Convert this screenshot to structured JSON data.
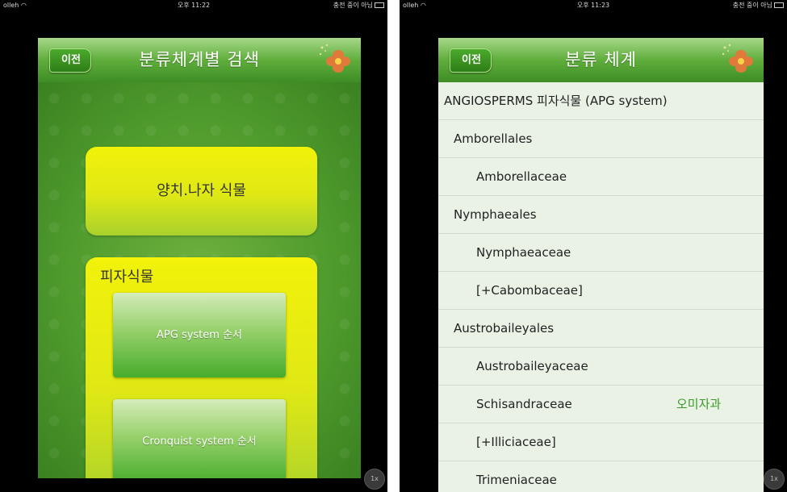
{
  "left": {
    "status": {
      "carrier": "olleh",
      "time": "오후 11:22",
      "charging": "충전 중이 아님"
    },
    "header": {
      "back_label": "이전",
      "title": "분류체계별 검색"
    },
    "gymnosperm_label": "양치.나자 식물",
    "angiosperm": {
      "title": "피자식물",
      "apg_label": "APG system 순서",
      "cronquist_label": "Cronquist system 순서"
    },
    "zoom": "1x"
  },
  "right": {
    "status": {
      "carrier": "olleh",
      "time": "오후 11:23",
      "charging": "충전 중이 아님"
    },
    "header": {
      "back_label": "이전",
      "title": "분류 체계"
    },
    "rows": [
      {
        "label": "ANGIOSPERMS 피자식물 (APG system)",
        "note": ""
      },
      {
        "label": "Amborellales",
        "note": ""
      },
      {
        "label": "Amborellaceae",
        "note": ""
      },
      {
        "label": "Nymphaeales",
        "note": ""
      },
      {
        "label": "Nymphaeaceae",
        "note": ""
      },
      {
        "label": "[+Cabombaceae]",
        "note": ""
      },
      {
        "label": "Austrobaileyales",
        "note": ""
      },
      {
        "label": "Austrobaileyaceae",
        "note": ""
      },
      {
        "label": "Schisandraceae",
        "note": "오미자과"
      },
      {
        "label": "[+Illiciaceae]",
        "note": ""
      },
      {
        "label": "Trimeniaceae",
        "note": ""
      }
    ],
    "zoom": "1x"
  },
  "colors": {
    "header_green": "#5fae3c",
    "list_bg": "#e9f2e4",
    "note_green": "#3a9a2a",
    "yellow": "#f2f20a"
  },
  "icons": {
    "flower": "flower-icon",
    "wifi": "wifi-icon",
    "battery": "battery-icon"
  }
}
